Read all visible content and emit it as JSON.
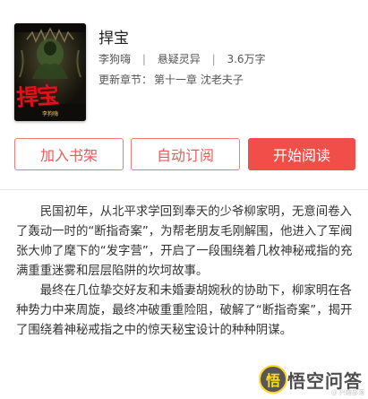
{
  "book": {
    "title": "捍宝",
    "author": "李狗嗨",
    "genre": "悬疑灵异",
    "word_count": "3.6万字",
    "update_label": "更新章节：",
    "latest_chapter": "第十一章 沈老夫子",
    "cover": {
      "title_text": "捍宝",
      "author_text": "李狗嗨"
    }
  },
  "actions": {
    "add_bookshelf": "加入书架",
    "auto_subscribe": "自动订阅",
    "start_reading": "开始阅读"
  },
  "synopsis": {
    "paragraphs": [
      "民国初年，从北平求学回到奉天的少爷柳家明，无意间卷入了轰动一时的“断指奇案”，为帮老朋友毛刚解围，他进入了军阀张大帅了麾下的“发字营”，开启了一段围绕着几枚神秘戒指的充满重重迷雾和层层陷阱的坎坷故事。",
      "最终在几位挚交好友和未婚妻胡婉秋的协助下，柳家明在各种势力中来周旋，最终冲破重重险阻，破解了“断指奇案”，揭开了围绕着神秘戒指之中的惊天秘宝设计的种种阴谋。"
    ]
  },
  "watermark": {
    "logo_char": "悟",
    "text": "悟空问答",
    "small_text": "@ 兴趣部落"
  },
  "colors": {
    "accent": "#f14e49",
    "outline": "#f07a78",
    "cover_title": "#d8141d"
  }
}
